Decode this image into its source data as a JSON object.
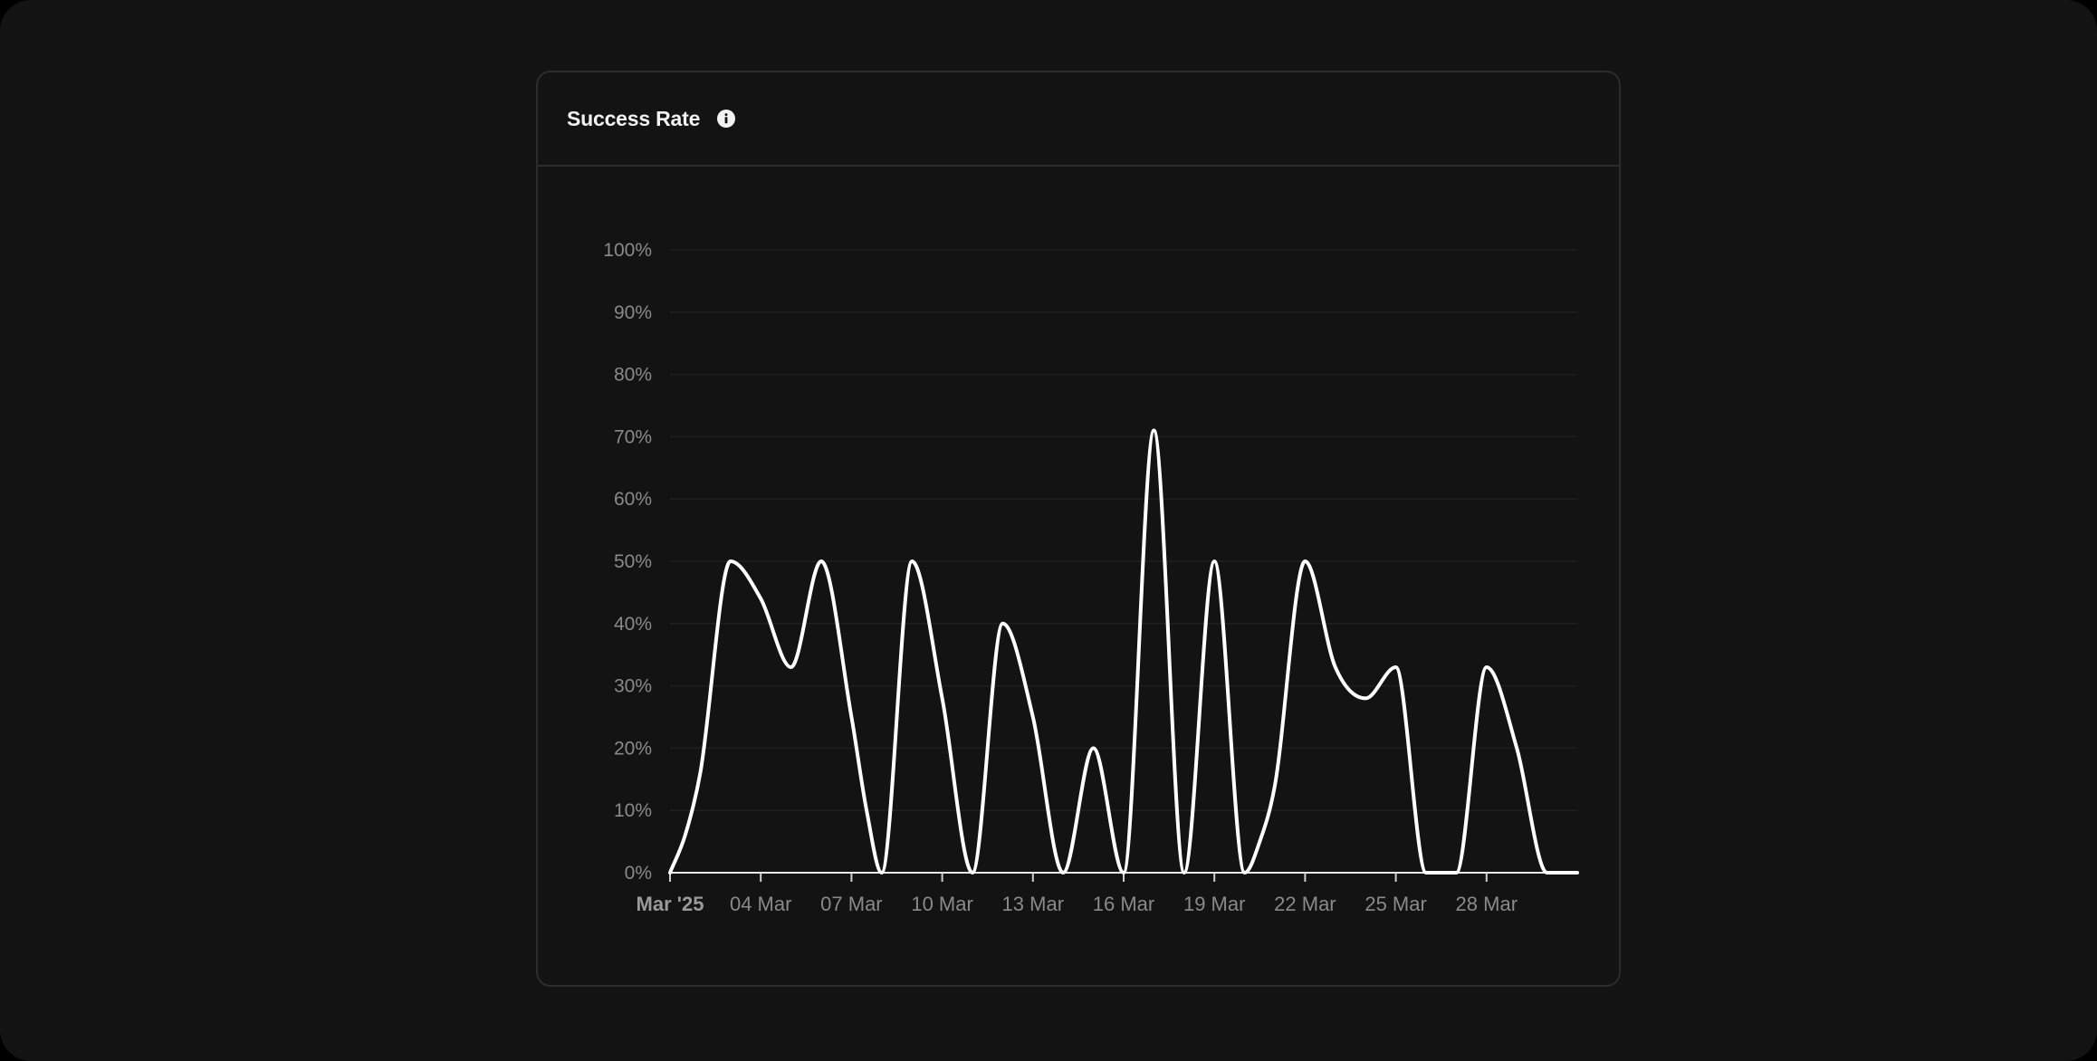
{
  "card": {
    "title": "Success Rate",
    "info_icon": "info-icon"
  },
  "colors": {
    "background": "#131313",
    "line": "#ffffff",
    "grid": "#1f1f1f",
    "tick_text": "#8a8a8a",
    "tick_text_strong": "#9a9a9a"
  },
  "chart_data": {
    "type": "line",
    "title": "",
    "xlabel": "",
    "ylabel": "",
    "ylim": [
      0,
      100
    ],
    "y_ticks": [
      "0%",
      "10%",
      "20%",
      "30%",
      "40%",
      "50%",
      "60%",
      "70%",
      "80%",
      "90%",
      "100%"
    ],
    "x_ticks": [
      "Mar '25",
      "04 Mar",
      "07 Mar",
      "10 Mar",
      "13 Mar",
      "16 Mar",
      "19 Mar",
      "22 Mar",
      "25 Mar",
      "28 Mar"
    ],
    "x_tick_days": [
      1,
      4,
      7,
      10,
      13,
      16,
      19,
      22,
      25,
      28
    ],
    "x_domain_days": [
      1,
      31
    ],
    "grid": true,
    "legend": "none",
    "series": [
      {
        "x": [
          1,
          1.5,
          2,
          3,
          4,
          5,
          6,
          7,
          7.5,
          8,
          9,
          10,
          11,
          12,
          13,
          14,
          15,
          16,
          17,
          18,
          19,
          20,
          20.5,
          21,
          22,
          23,
          24,
          25,
          26,
          27,
          28,
          29,
          30,
          31
        ],
        "values": [
          0,
          6,
          16,
          50,
          44,
          33,
          50,
          25,
          10,
          0,
          50,
          28,
          0,
          40,
          25,
          0,
          20,
          0,
          71,
          0,
          50,
          0,
          5,
          14,
          50,
          33,
          28,
          33,
          0,
          0,
          33,
          20,
          0,
          0
        ]
      }
    ]
  }
}
